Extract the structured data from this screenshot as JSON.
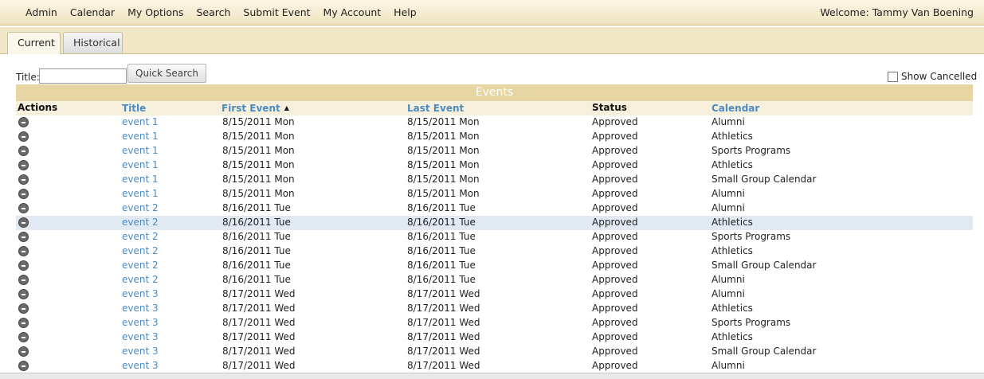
{
  "menu": {
    "items": [
      "Admin",
      "Calendar",
      "My Options",
      "Search",
      "Submit Event",
      "My Account",
      "Help"
    ],
    "welcome": "Welcome: Tammy Van Boening"
  },
  "tabs": [
    {
      "label": "Current",
      "active": true
    },
    {
      "label": "Historical",
      "active": false
    }
  ],
  "search": {
    "title_label": "Title:",
    "title_value": "",
    "button_label": "Quick Search",
    "show_cancelled_label": "Show Cancelled",
    "show_cancelled_checked": false
  },
  "table": {
    "caption": "Events",
    "columns": {
      "actions": "Actions",
      "title": "Title",
      "first_event": "First Event",
      "last_event": "Last Event",
      "status": "Status",
      "calendar": "Calendar"
    },
    "sort": {
      "column": "first_event",
      "direction": "ascending"
    },
    "highlighted_row_index": 7,
    "rows": [
      {
        "title": "event 1",
        "first": "8/15/2011 Mon",
        "last": "8/15/2011 Mon",
        "status": "Approved",
        "calendar": "Alumni"
      },
      {
        "title": "event 1",
        "first": "8/15/2011 Mon",
        "last": "8/15/2011 Mon",
        "status": "Approved",
        "calendar": "Athletics"
      },
      {
        "title": "event 1",
        "first": "8/15/2011 Mon",
        "last": "8/15/2011 Mon",
        "status": "Approved",
        "calendar": "Sports Programs"
      },
      {
        "title": "event 1",
        "first": "8/15/2011 Mon",
        "last": "8/15/2011 Mon",
        "status": "Approved",
        "calendar": "Athletics"
      },
      {
        "title": "event 1",
        "first": "8/15/2011 Mon",
        "last": "8/15/2011 Mon",
        "status": "Approved",
        "calendar": "Small Group Calendar"
      },
      {
        "title": "event 1",
        "first": "8/15/2011 Mon",
        "last": "8/15/2011 Mon",
        "status": "Approved",
        "calendar": "Alumni"
      },
      {
        "title": "event 2",
        "first": "8/16/2011 Tue",
        "last": "8/16/2011 Tue",
        "status": "Approved",
        "calendar": "Alumni"
      },
      {
        "title": "event 2",
        "first": "8/16/2011 Tue",
        "last": "8/16/2011 Tue",
        "status": "Approved",
        "calendar": "Athletics"
      },
      {
        "title": "event 2",
        "first": "8/16/2011 Tue",
        "last": "8/16/2011 Tue",
        "status": "Approved",
        "calendar": "Sports Programs"
      },
      {
        "title": "event 2",
        "first": "8/16/2011 Tue",
        "last": "8/16/2011 Tue",
        "status": "Approved",
        "calendar": "Athletics"
      },
      {
        "title": "event 2",
        "first": "8/16/2011 Tue",
        "last": "8/16/2011 Tue",
        "status": "Approved",
        "calendar": "Small Group Calendar"
      },
      {
        "title": "event 2",
        "first": "8/16/2011 Tue",
        "last": "8/16/2011 Tue",
        "status": "Approved",
        "calendar": "Alumni"
      },
      {
        "title": "event 3",
        "first": "8/17/2011 Wed",
        "last": "8/17/2011 Wed",
        "status": "Approved",
        "calendar": "Alumni"
      },
      {
        "title": "event 3",
        "first": "8/17/2011 Wed",
        "last": "8/17/2011 Wed",
        "status": "Approved",
        "calendar": "Athletics"
      },
      {
        "title": "event 3",
        "first": "8/17/2011 Wed",
        "last": "8/17/2011 Wed",
        "status": "Approved",
        "calendar": "Sports Programs"
      },
      {
        "title": "event 3",
        "first": "8/17/2011 Wed",
        "last": "8/17/2011 Wed",
        "status": "Approved",
        "calendar": "Athletics"
      },
      {
        "title": "event 3",
        "first": "8/17/2011 Wed",
        "last": "8/17/2011 Wed",
        "status": "Approved",
        "calendar": "Small Group Calendar"
      },
      {
        "title": "event 3",
        "first": "8/17/2011 Wed",
        "last": "8/17/2011 Wed",
        "status": "Approved",
        "calendar": "Alumni"
      }
    ]
  },
  "colors": {
    "link": "#4b8bc0",
    "caption_bar": "#e7d5a3",
    "header_bar": "#f6efdb",
    "highlight_row": "#e1e9f2"
  },
  "icons": {
    "row_action": "action-menu-icon",
    "sort": "sort-ascending-icon"
  }
}
